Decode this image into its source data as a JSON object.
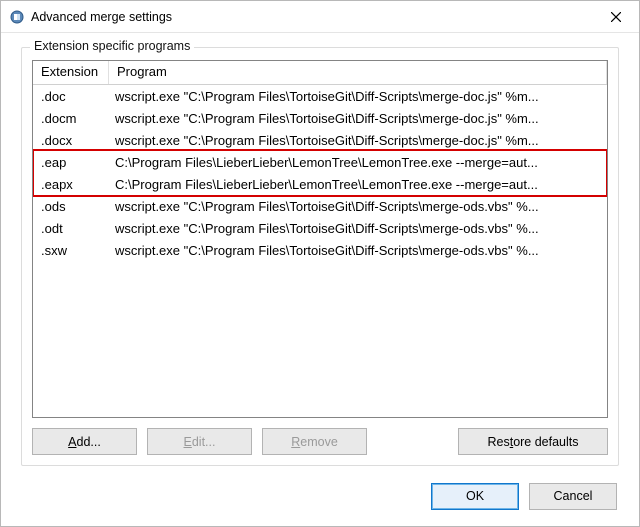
{
  "window": {
    "title": "Advanced merge settings"
  },
  "group": {
    "label": "Extension specific programs"
  },
  "columns": {
    "ext": "Extension",
    "prog": "Program"
  },
  "rows": [
    {
      "ext": ".doc",
      "prog": "wscript.exe \"C:\\Program Files\\TortoiseGit\\Diff-Scripts\\merge-doc.js\" %m..."
    },
    {
      "ext": ".docm",
      "prog": "wscript.exe \"C:\\Program Files\\TortoiseGit\\Diff-Scripts\\merge-doc.js\" %m..."
    },
    {
      "ext": ".docx",
      "prog": "wscript.exe \"C:\\Program Files\\TortoiseGit\\Diff-Scripts\\merge-doc.js\" %m..."
    },
    {
      "ext": ".eap",
      "prog": "C:\\Program Files\\LieberLieber\\LemonTree\\LemonTree.exe --merge=aut..."
    },
    {
      "ext": ".eapx",
      "prog": "C:\\Program Files\\LieberLieber\\LemonTree\\LemonTree.exe --merge=aut..."
    },
    {
      "ext": ".ods",
      "prog": "wscript.exe \"C:\\Program Files\\TortoiseGit\\Diff-Scripts\\merge-ods.vbs\" %..."
    },
    {
      "ext": ".odt",
      "prog": "wscript.exe \"C:\\Program Files\\TortoiseGit\\Diff-Scripts\\merge-ods.vbs\" %..."
    },
    {
      "ext": ".sxw",
      "prog": "wscript.exe \"C:\\Program Files\\TortoiseGit\\Diff-Scripts\\merge-ods.vbs\" %..."
    }
  ],
  "highlight": {
    "from_row": 3,
    "to_row": 4
  },
  "buttons": {
    "add": "Add...",
    "edit": "Edit...",
    "remove": "Remove",
    "restore": "Restore defaults",
    "ok": "OK",
    "cancel": "Cancel"
  }
}
